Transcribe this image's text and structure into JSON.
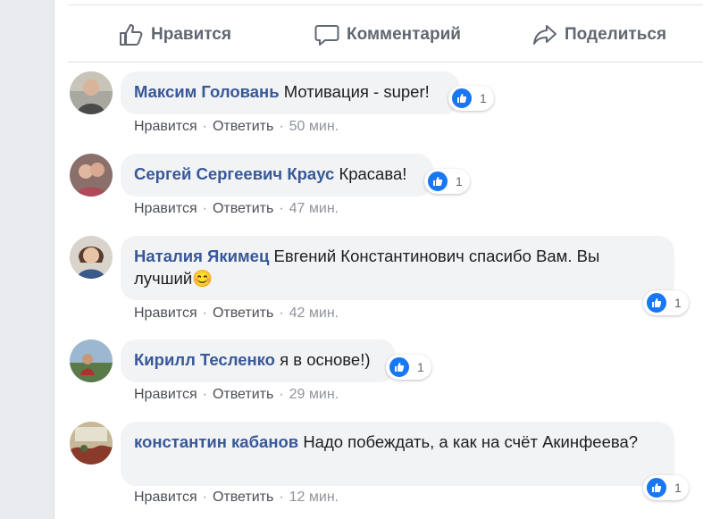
{
  "actions": {
    "like": "Нравится",
    "comment": "Комментарий",
    "share": "Поделиться"
  },
  "meta_labels": {
    "like": "Нравится",
    "reply": "Ответить",
    "separator": "·"
  },
  "colors": {
    "author": "#385898",
    "like_blue": "#1877f2",
    "bubble": "#f2f3f5"
  },
  "comments": [
    {
      "author": "Максим Головань",
      "text": "Мотивация - super!",
      "reactions": "1",
      "time": "50 мин."
    },
    {
      "author": "Сергей Сергеевич Краус",
      "text": "Красава!",
      "reactions": "1",
      "time": "47 мин."
    },
    {
      "author": "Наталия Якимец",
      "text": "Евгений Константинович спасибо Вам. Вы лучший",
      "emoji": "😊",
      "reactions": "1",
      "time": "42 мин."
    },
    {
      "author": "Кирилл Тесленко",
      "text": "я в основе!)",
      "reactions": "1",
      "time": "29 мин."
    },
    {
      "author": "константин кабанов",
      "text": "Надо побеждать, а как на счёт Акинфеева?",
      "reactions": "1",
      "time": "12 мин."
    }
  ]
}
